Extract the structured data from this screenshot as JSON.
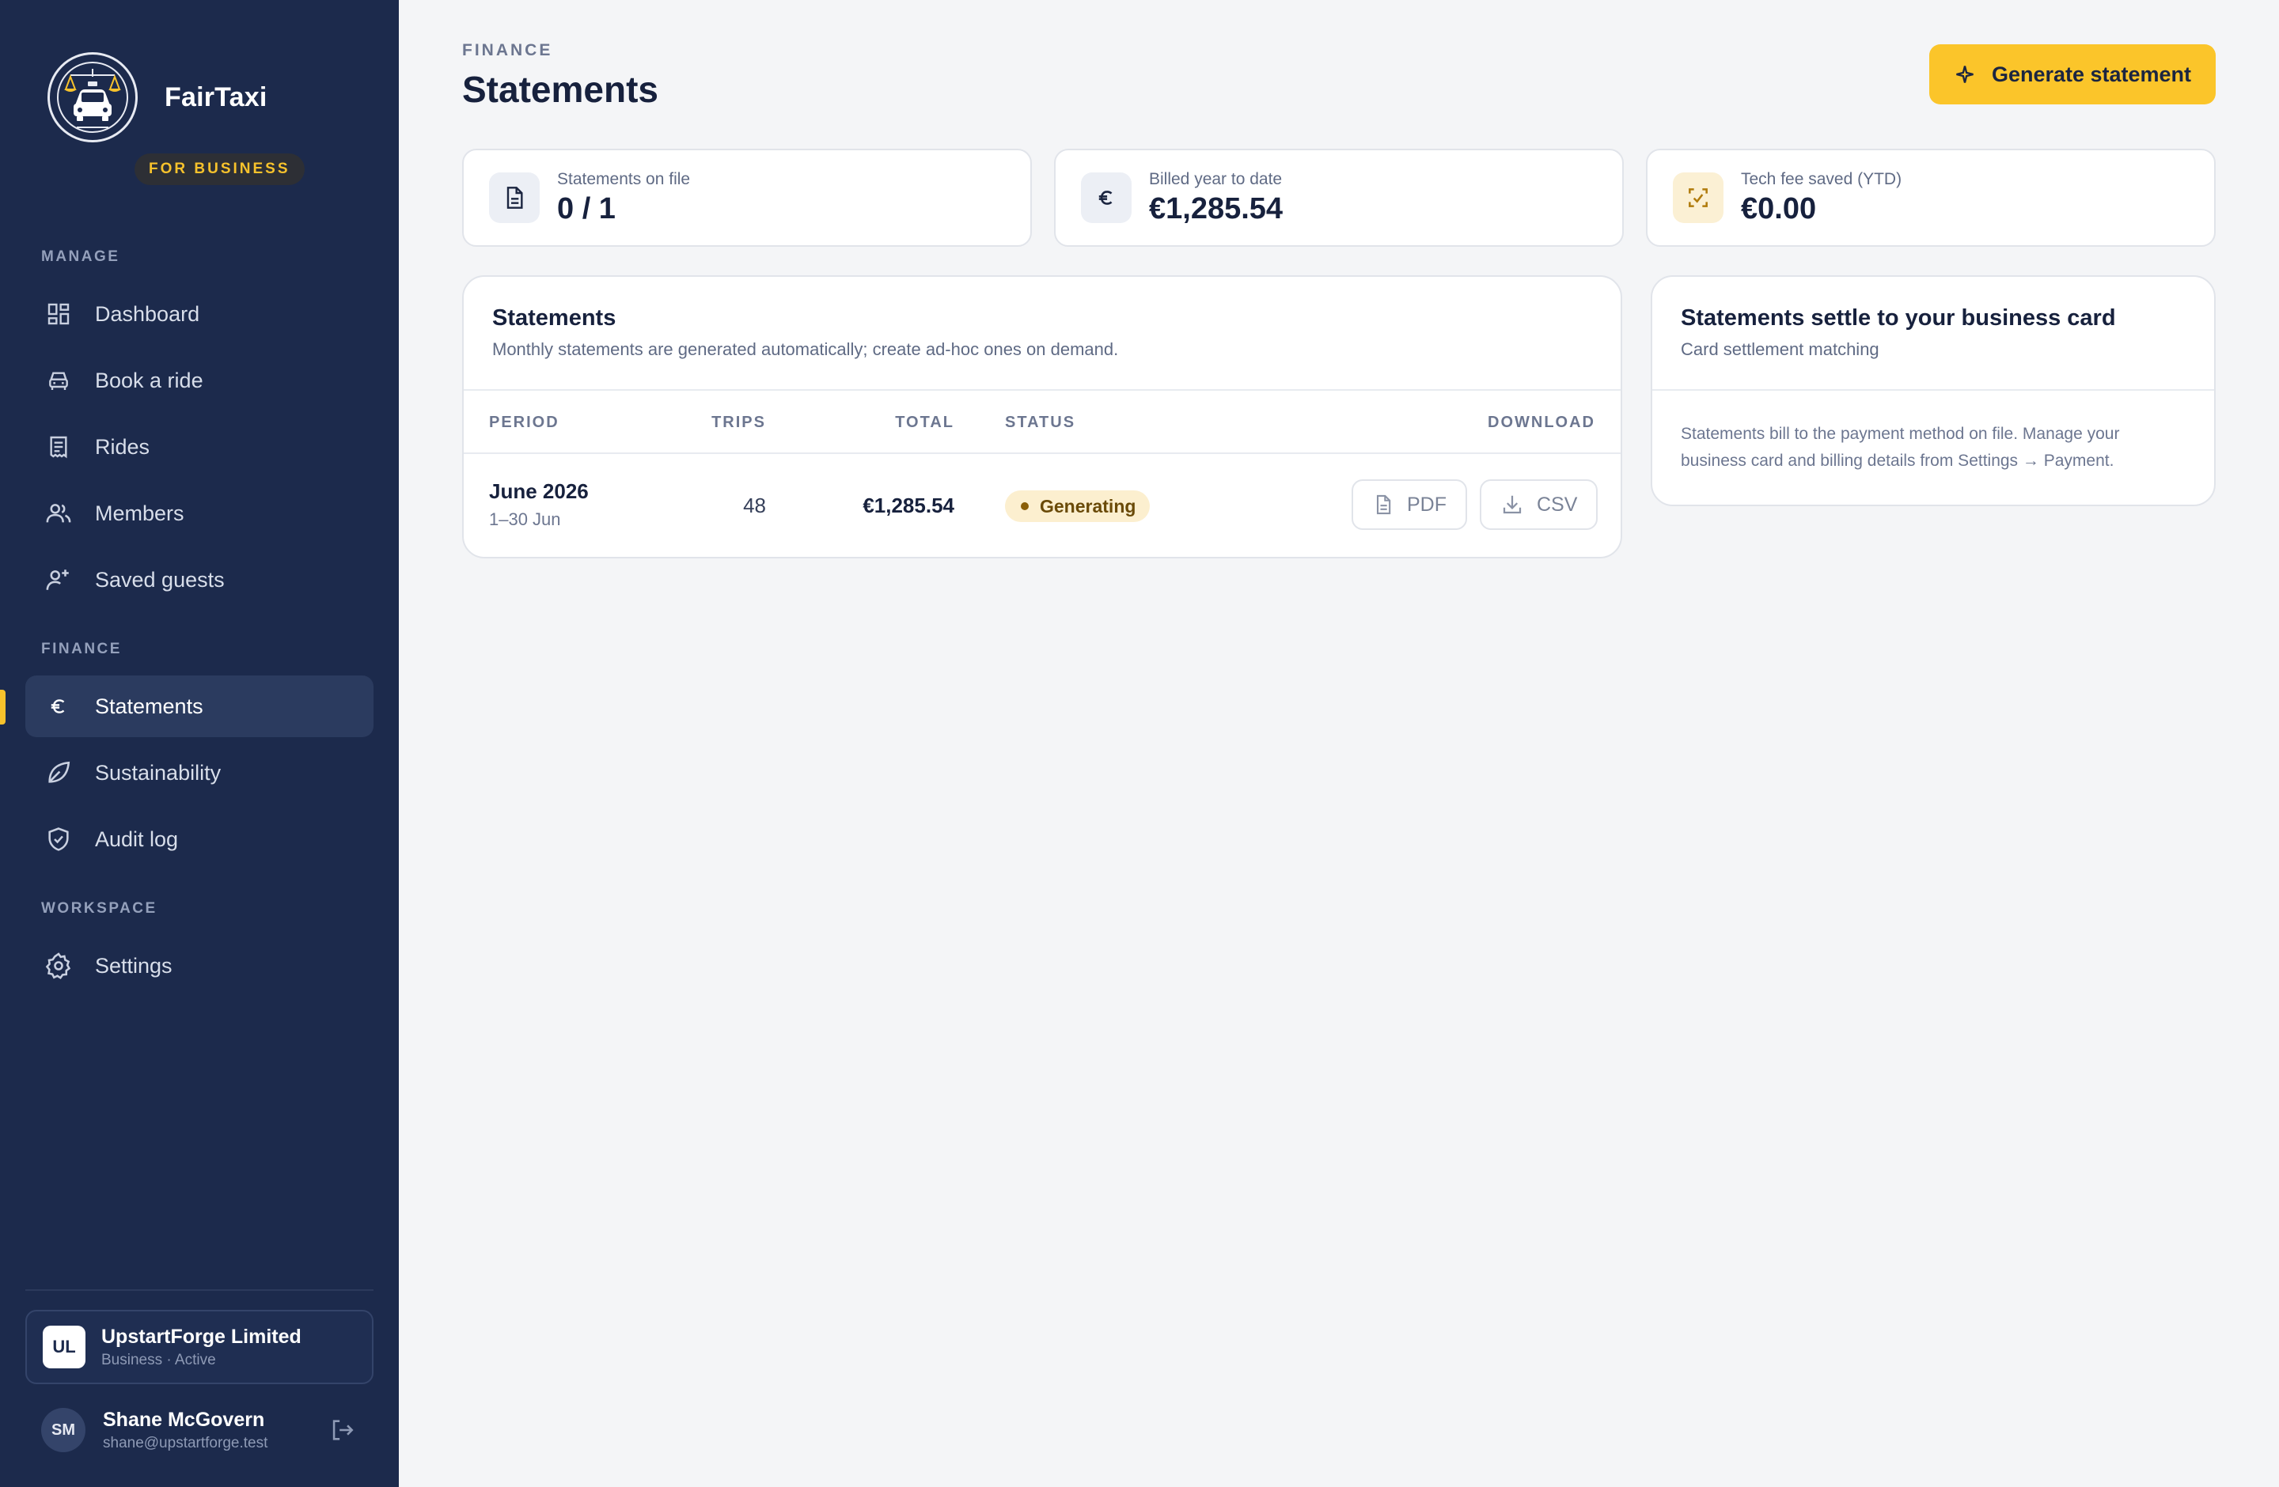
{
  "sidebar": {
    "brand_name": "FairTaxi",
    "brand_badge": "FOR BUSINESS",
    "sections": {
      "manage": "MANAGE",
      "finance": "FINANCE",
      "workspace": "WORKSPACE"
    },
    "items": {
      "dashboard": "Dashboard",
      "book_ride": "Book a ride",
      "rides": "Rides",
      "members": "Members",
      "saved_guests": "Saved guests",
      "statements": "Statements",
      "sustainability": "Sustainability",
      "audit_log": "Audit log",
      "settings": "Settings"
    },
    "active_item": "statements",
    "org": {
      "initials": "UL",
      "name": "UpstartForge Limited",
      "subtitle": "Business · Active"
    },
    "user": {
      "initials": "SM",
      "name": "Shane McGovern",
      "email": "shane@upstartforge.test"
    }
  },
  "header": {
    "eyebrow": "FINANCE",
    "title": "Statements",
    "primary_button": "Generate statement"
  },
  "stats": [
    {
      "label": "Statements on file",
      "value": "0 / 1",
      "icon": "document-icon"
    },
    {
      "label": "Billed year to date",
      "value": "€1,285.54",
      "icon": "euro-icon"
    },
    {
      "label": "Tech fee saved (YTD)",
      "value": "€0.00",
      "icon": "scan-icon"
    }
  ],
  "statements_panel": {
    "title": "Statements",
    "subtitle": "Monthly statements are generated automatically; create ad-hoc ones on demand.",
    "columns": {
      "period": "PERIOD",
      "trips": "TRIPS",
      "total": "TOTAL",
      "status": "STATUS",
      "download": "DOWNLOAD"
    },
    "rows": [
      {
        "period": "June 2026",
        "range": "1–30 Jun",
        "trips": "48",
        "total": "€1,285.54",
        "status": "Generating",
        "pdf_label": "PDF",
        "csv_label": "CSV"
      }
    ]
  },
  "settlement_panel": {
    "title": "Statements settle to your business card",
    "subtitle": "Card settlement matching",
    "body": "Statements bill to the payment method on file. Manage your business card and billing details from Settings → Payment."
  },
  "colors": {
    "sidebar_bg": "#1c2a4c",
    "accent": "#fbc52a",
    "page_bg": "#f4f5f7",
    "status_generating_bg": "#fcefcf"
  }
}
